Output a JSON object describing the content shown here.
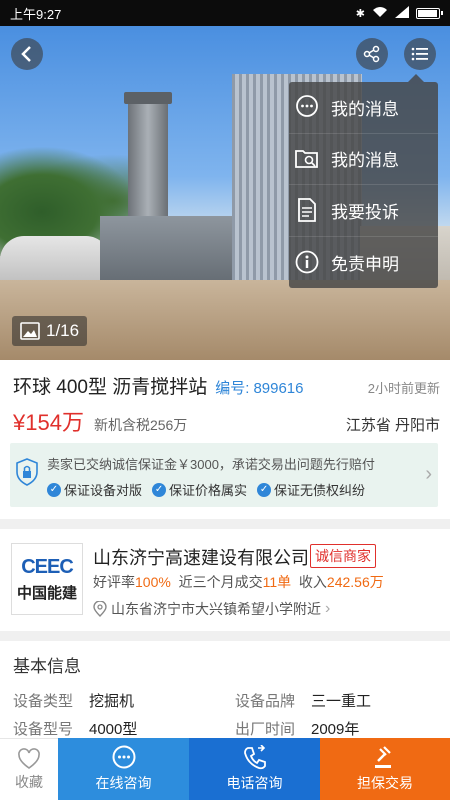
{
  "status_bar": {
    "time": "上午9:27"
  },
  "hero": {
    "image_counter": "1/16"
  },
  "popup_menu": {
    "items": [
      {
        "label": "我的消息",
        "icon": "message-bubble-icon"
      },
      {
        "label": "我的消息",
        "icon": "folder-search-icon"
      },
      {
        "label": "我要投诉",
        "icon": "document-icon"
      },
      {
        "label": "免责申明",
        "icon": "info-icon"
      }
    ]
  },
  "listing": {
    "title": "环球 400型 沥青搅拌站",
    "code_label": "编号:",
    "code_value": "899616",
    "updated": "2小时前更新",
    "price": "¥154万",
    "new_price": "新机含税256万",
    "location": "江苏省 丹阳市"
  },
  "guarantee": {
    "text": "卖家已交纳诚信保证金￥3000，承诺交易出问题先行赔付",
    "chips": [
      "保证设备对版",
      "保证价格属实",
      "保证无债权纠纷"
    ]
  },
  "seller": {
    "logo_line1": "CEEC",
    "logo_line2": "中国能建",
    "company": "山东济宁高速建设有限公司",
    "badge": "诚信商家",
    "rating_label": "好评率",
    "rating_value": "100%",
    "deals_label": "近三个月成交",
    "deals_value": "11单",
    "income_label": "收入",
    "income_value": "242.56万",
    "address": "山东省济宁市大兴镇希望小学附近"
  },
  "basic_info": {
    "title": "基本信息",
    "rows": [
      {
        "k1": "设备类型",
        "v1": "挖掘机",
        "k2": "设备品牌",
        "v2": "三一重工"
      },
      {
        "k1": "设备型号",
        "v1": "4000型",
        "k2": "出厂时间",
        "v2": "2009年"
      }
    ]
  },
  "bottom_bar": {
    "favorite": "收藏",
    "chat": "在线咨询",
    "phone": "电话咨询",
    "deal": "担保交易"
  },
  "colors": {
    "accent_blue": "#2d8ddd",
    "dark_blue": "#1a6fd2",
    "orange": "#f06a13",
    "price_red": "#e0302c"
  }
}
